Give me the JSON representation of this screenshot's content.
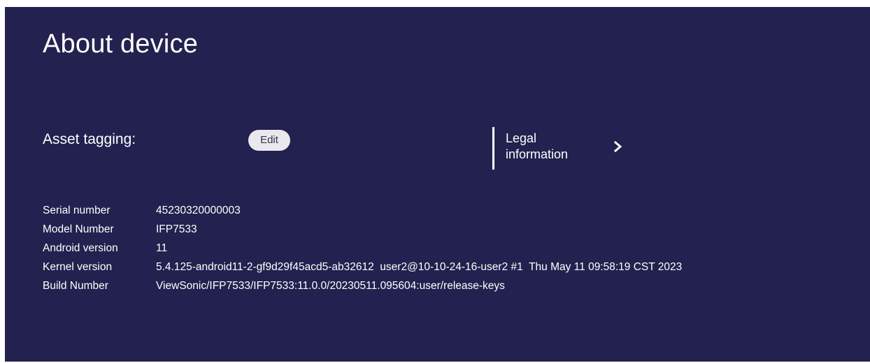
{
  "colors": {
    "panel_background": "#23214f",
    "text": "#ffffff",
    "edit_button_background": "#e9e8ef"
  },
  "header": {
    "title": "About device"
  },
  "asset_tagging": {
    "label": "Asset tagging:",
    "edit_label": "Edit"
  },
  "legal": {
    "label": "Legal information",
    "icon": "chevron-right-icon"
  },
  "info": [
    {
      "key": "Serial number",
      "value": "45230320000003"
    },
    {
      "key": "Model Number",
      "value": "IFP7533"
    },
    {
      "key": "Android version",
      "value": "11"
    },
    {
      "key": "Kernel version",
      "value": "5.4.125-android11-2-gf9d29f45acd5-ab32612  user2@10-10-24-16-user2 #1  Thu May 11 09:58:19 CST 2023"
    },
    {
      "key": "Build Number",
      "value": "ViewSonic/IFP7533/IFP7533:11.0.0/20230511.095604:user/release-keys"
    }
  ]
}
